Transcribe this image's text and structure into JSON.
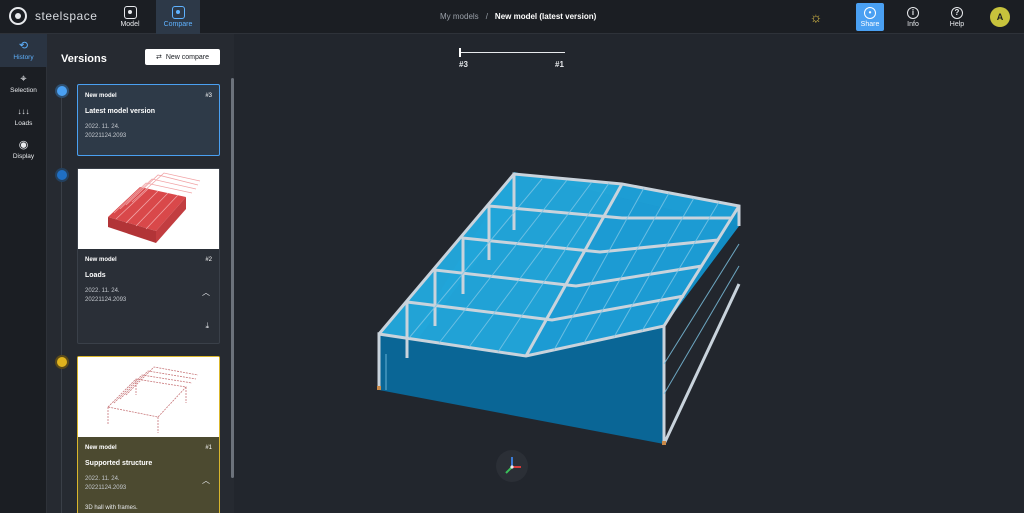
{
  "app": {
    "name": "steelspace"
  },
  "topnav": [
    {
      "label": "Model",
      "icon": "model-icon",
      "active": false
    },
    {
      "label": "Compare",
      "icon": "compare-icon",
      "active": true
    }
  ],
  "breadcrumb": {
    "parent": "My models",
    "separator": "/",
    "current": "New model (latest version)"
  },
  "toolbar": {
    "theme_icon": "sun-icon",
    "share_label": "Share",
    "info_label": "Info",
    "help_label": "Help",
    "avatar_initial": "A"
  },
  "leftrail": [
    {
      "label": "History",
      "icon": "history-icon",
      "glyph": "⟲",
      "active": true
    },
    {
      "label": "Selection",
      "icon": "selection-icon",
      "glyph": "⌖",
      "active": false
    },
    {
      "label": "Loads",
      "icon": "loads-icon",
      "glyph": "↓↓↓",
      "active": false
    },
    {
      "label": "Display",
      "icon": "eye-icon",
      "glyph": "◉",
      "active": false
    }
  ],
  "versions": {
    "title": "Versions",
    "new_compare_label": "New compare",
    "items": [
      {
        "model": "New model",
        "number": "#3",
        "title": "Latest model version",
        "date": "2022. 11. 24.",
        "id": "20221124.2093",
        "dot_color": "#4aa0f2"
      },
      {
        "model": "New model",
        "number": "#2",
        "title": "Loads",
        "date": "2022. 11. 24.",
        "id": "20221124.2093",
        "dot_color": "#1f6fc4"
      },
      {
        "model": "New model",
        "number": "#1",
        "title": "Supported structure",
        "date": "2022. 11. 24.",
        "id": "20221124.2093",
        "description": "3D hall with frames.",
        "dot_color": "#e0b31e"
      }
    ]
  },
  "version_slider": {
    "left_label": "#3",
    "right_label": "#1",
    "position": 0
  },
  "colors": {
    "accent": "#4aa0f2",
    "panel": "#262a31",
    "viewport": "#22262d",
    "roof": "#0b7fb4",
    "wall": "#0a6696"
  }
}
